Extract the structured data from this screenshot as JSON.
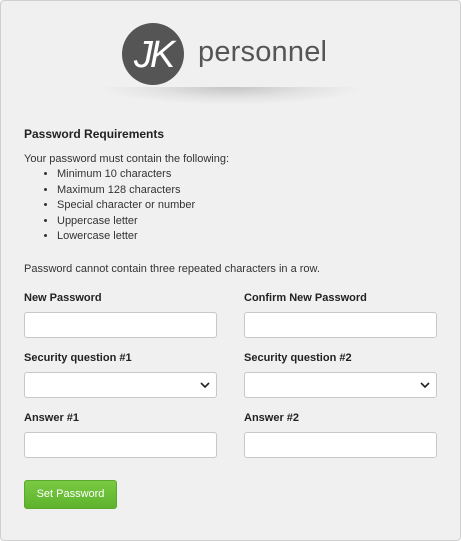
{
  "brand": {
    "logo_mark": "JK",
    "name": "personnel"
  },
  "requirements": {
    "title": "Password Requirements",
    "intro": "Your password must contain the following:",
    "items": [
      "Minimum 10 characters",
      "Maximum 128 characters",
      "Special character or number",
      "Uppercase letter",
      "Lowercase letter"
    ],
    "note": "Password cannot contain three repeated characters in a row."
  },
  "form": {
    "new_password": {
      "label": "New Password",
      "value": "",
      "placeholder": ""
    },
    "confirm_password": {
      "label": "Confirm New Password",
      "value": "",
      "placeholder": ""
    },
    "security_question_1": {
      "label": "Security question #1",
      "selected": ""
    },
    "security_question_2": {
      "label": "Security question #2",
      "selected": ""
    },
    "answer_1": {
      "label": "Answer #1",
      "value": "",
      "placeholder": ""
    },
    "answer_2": {
      "label": "Answer #2",
      "value": "",
      "placeholder": ""
    },
    "submit_label": "Set Password"
  },
  "colors": {
    "background": "#f0f0f0",
    "logo_circle": "#555555",
    "button_green": "#6cbf38",
    "text": "#222222"
  }
}
